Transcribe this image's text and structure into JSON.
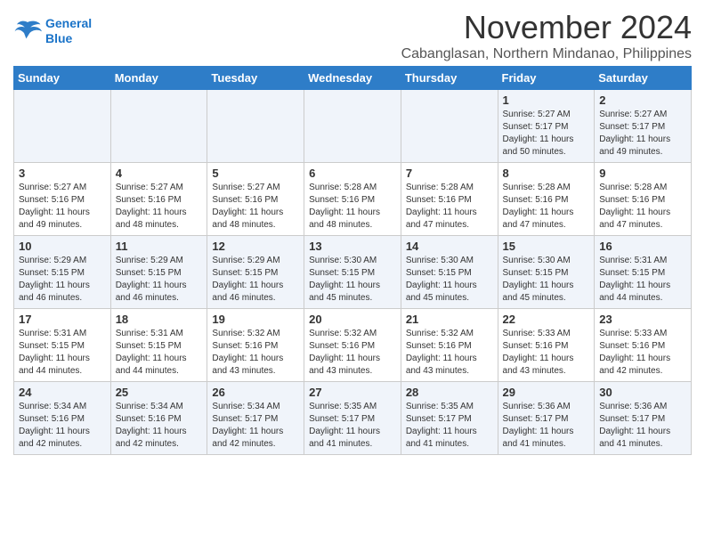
{
  "logo": {
    "line1": "General",
    "line2": "Blue"
  },
  "title": "November 2024",
  "location": "Cabanglasan, Northern Mindanao, Philippines",
  "headers": [
    "Sunday",
    "Monday",
    "Tuesday",
    "Wednesday",
    "Thursday",
    "Friday",
    "Saturday"
  ],
  "weeks": [
    [
      {
        "day": "",
        "info": ""
      },
      {
        "day": "",
        "info": ""
      },
      {
        "day": "",
        "info": ""
      },
      {
        "day": "",
        "info": ""
      },
      {
        "day": "",
        "info": ""
      },
      {
        "day": "1",
        "info": "Sunrise: 5:27 AM\nSunset: 5:17 PM\nDaylight: 11 hours\nand 50 minutes."
      },
      {
        "day": "2",
        "info": "Sunrise: 5:27 AM\nSunset: 5:17 PM\nDaylight: 11 hours\nand 49 minutes."
      }
    ],
    [
      {
        "day": "3",
        "info": "Sunrise: 5:27 AM\nSunset: 5:16 PM\nDaylight: 11 hours\nand 49 minutes."
      },
      {
        "day": "4",
        "info": "Sunrise: 5:27 AM\nSunset: 5:16 PM\nDaylight: 11 hours\nand 48 minutes."
      },
      {
        "day": "5",
        "info": "Sunrise: 5:27 AM\nSunset: 5:16 PM\nDaylight: 11 hours\nand 48 minutes."
      },
      {
        "day": "6",
        "info": "Sunrise: 5:28 AM\nSunset: 5:16 PM\nDaylight: 11 hours\nand 48 minutes."
      },
      {
        "day": "7",
        "info": "Sunrise: 5:28 AM\nSunset: 5:16 PM\nDaylight: 11 hours\nand 47 minutes."
      },
      {
        "day": "8",
        "info": "Sunrise: 5:28 AM\nSunset: 5:16 PM\nDaylight: 11 hours\nand 47 minutes."
      },
      {
        "day": "9",
        "info": "Sunrise: 5:28 AM\nSunset: 5:16 PM\nDaylight: 11 hours\nand 47 minutes."
      }
    ],
    [
      {
        "day": "10",
        "info": "Sunrise: 5:29 AM\nSunset: 5:15 PM\nDaylight: 11 hours\nand 46 minutes."
      },
      {
        "day": "11",
        "info": "Sunrise: 5:29 AM\nSunset: 5:15 PM\nDaylight: 11 hours\nand 46 minutes."
      },
      {
        "day": "12",
        "info": "Sunrise: 5:29 AM\nSunset: 5:15 PM\nDaylight: 11 hours\nand 46 minutes."
      },
      {
        "day": "13",
        "info": "Sunrise: 5:30 AM\nSunset: 5:15 PM\nDaylight: 11 hours\nand 45 minutes."
      },
      {
        "day": "14",
        "info": "Sunrise: 5:30 AM\nSunset: 5:15 PM\nDaylight: 11 hours\nand 45 minutes."
      },
      {
        "day": "15",
        "info": "Sunrise: 5:30 AM\nSunset: 5:15 PM\nDaylight: 11 hours\nand 45 minutes."
      },
      {
        "day": "16",
        "info": "Sunrise: 5:31 AM\nSunset: 5:15 PM\nDaylight: 11 hours\nand 44 minutes."
      }
    ],
    [
      {
        "day": "17",
        "info": "Sunrise: 5:31 AM\nSunset: 5:15 PM\nDaylight: 11 hours\nand 44 minutes."
      },
      {
        "day": "18",
        "info": "Sunrise: 5:31 AM\nSunset: 5:15 PM\nDaylight: 11 hours\nand 44 minutes."
      },
      {
        "day": "19",
        "info": "Sunrise: 5:32 AM\nSunset: 5:16 PM\nDaylight: 11 hours\nand 43 minutes."
      },
      {
        "day": "20",
        "info": "Sunrise: 5:32 AM\nSunset: 5:16 PM\nDaylight: 11 hours\nand 43 minutes."
      },
      {
        "day": "21",
        "info": "Sunrise: 5:32 AM\nSunset: 5:16 PM\nDaylight: 11 hours\nand 43 minutes."
      },
      {
        "day": "22",
        "info": "Sunrise: 5:33 AM\nSunset: 5:16 PM\nDaylight: 11 hours\nand 43 minutes."
      },
      {
        "day": "23",
        "info": "Sunrise: 5:33 AM\nSunset: 5:16 PM\nDaylight: 11 hours\nand 42 minutes."
      }
    ],
    [
      {
        "day": "24",
        "info": "Sunrise: 5:34 AM\nSunset: 5:16 PM\nDaylight: 11 hours\nand 42 minutes."
      },
      {
        "day": "25",
        "info": "Sunrise: 5:34 AM\nSunset: 5:16 PM\nDaylight: 11 hours\nand 42 minutes."
      },
      {
        "day": "26",
        "info": "Sunrise: 5:34 AM\nSunset: 5:17 PM\nDaylight: 11 hours\nand 42 minutes."
      },
      {
        "day": "27",
        "info": "Sunrise: 5:35 AM\nSunset: 5:17 PM\nDaylight: 11 hours\nand 41 minutes."
      },
      {
        "day": "28",
        "info": "Sunrise: 5:35 AM\nSunset: 5:17 PM\nDaylight: 11 hours\nand 41 minutes."
      },
      {
        "day": "29",
        "info": "Sunrise: 5:36 AM\nSunset: 5:17 PM\nDaylight: 11 hours\nand 41 minutes."
      },
      {
        "day": "30",
        "info": "Sunrise: 5:36 AM\nSunset: 5:17 PM\nDaylight: 11 hours\nand 41 minutes."
      }
    ]
  ]
}
